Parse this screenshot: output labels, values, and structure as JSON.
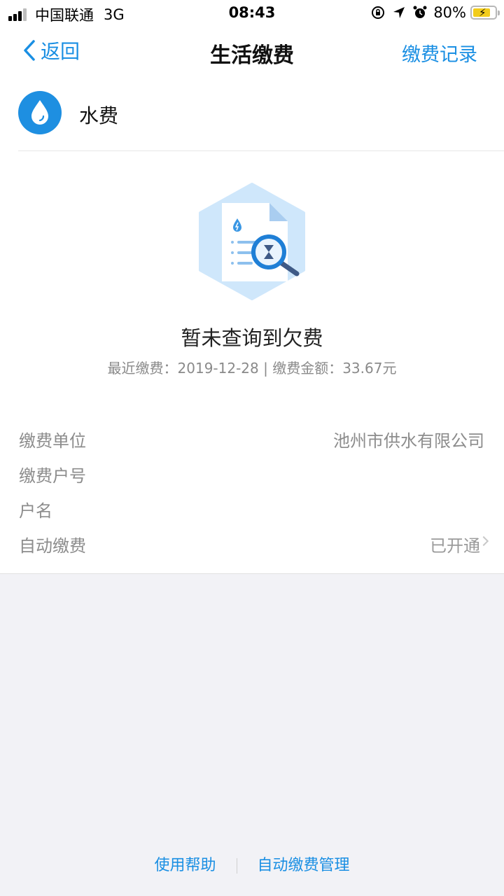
{
  "status_bar": {
    "carrier": "中国联通",
    "network": "3G",
    "time": "08:43",
    "battery_percent": "80%",
    "battery_level": 0.8,
    "icons": [
      "signal-icon",
      "lock-rotation-icon",
      "location-arrow-icon",
      "alarm-icon",
      "battery-charging-icon"
    ]
  },
  "nav": {
    "back_label": "返回",
    "title": "生活缴费",
    "right_label": "缴费记录"
  },
  "service": {
    "icon": "water-drop-icon",
    "name": "水费"
  },
  "empty_state": {
    "illustration": "document-search-icon",
    "title": "暂未查询到欠费",
    "subtitle": "最近缴费：2019-12-28 | 缴费金额：33.67元"
  },
  "info": [
    {
      "label": "缴费单位",
      "value": "池州市供水有限公司"
    },
    {
      "label": "缴费户号",
      "value": ""
    },
    {
      "label": "户名",
      "value": ""
    },
    {
      "label": "自动缴费",
      "value": "已开通"
    }
  ],
  "footer": {
    "help_label": "使用帮助",
    "auto_manage_label": "自动缴费管理"
  },
  "colors": {
    "accent": "#1a8fe3",
    "water_icon": "#1e8fe1",
    "illustration_bg": "#cfe7fb",
    "page_bg": "#f2f2f6"
  }
}
